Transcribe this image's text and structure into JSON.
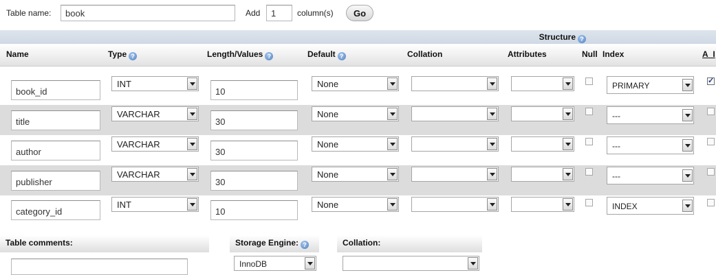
{
  "top": {
    "table_name_label": "Table name:",
    "table_name_value": "book",
    "add_label": "Add",
    "add_count": "1",
    "columns_label": "column(s)",
    "go_label": "Go"
  },
  "structure_title": "Structure",
  "headers": {
    "name": "Name",
    "type": "Type",
    "length": "Length/Values",
    "default": "Default",
    "collation": "Collation",
    "attributes": "Attributes",
    "null": "Null",
    "index": "Index",
    "ai": "A_I"
  },
  "rows": [
    {
      "name": "book_id",
      "type": "INT",
      "length": "10",
      "default": "None",
      "collation": "",
      "attributes": "",
      "null": false,
      "index": "PRIMARY",
      "ai": true
    },
    {
      "name": "title",
      "type": "VARCHAR",
      "length": "30",
      "default": "None",
      "collation": "",
      "attributes": "",
      "null": false,
      "index": "---",
      "ai": false
    },
    {
      "name": "author",
      "type": "VARCHAR",
      "length": "30",
      "default": "None",
      "collation": "",
      "attributes": "",
      "null": false,
      "index": "---",
      "ai": false
    },
    {
      "name": "publisher",
      "type": "VARCHAR",
      "length": "30",
      "default": "None",
      "collation": "",
      "attributes": "",
      "null": false,
      "index": "---",
      "ai": false
    },
    {
      "name": "category_id",
      "type": "INT",
      "length": "10",
      "default": "None",
      "collation": "",
      "attributes": "",
      "null": false,
      "index": "INDEX",
      "ai": false
    }
  ],
  "bottom": {
    "comments_label": "Table comments:",
    "comments_value": "",
    "engine_label": "Storage Engine:",
    "engine_value": "InnoDB",
    "collation_label": "Collation:",
    "collation_value": ""
  },
  "icons": {
    "help": "help-circle-icon",
    "dropdown": "dropdown-arrow-icon",
    "checkbox": "checkbox-icon"
  }
}
